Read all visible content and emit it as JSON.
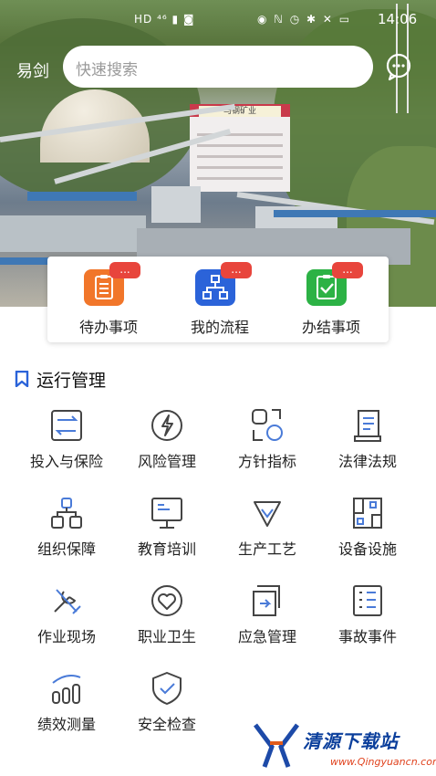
{
  "status_bar": {
    "left_icons": "HD ⁴⁶ ▮ ◙",
    "right_icons": "◉ ℕ ◷ ✱ ✕ ▭",
    "time": "14:06"
  },
  "header": {
    "user_name": "易剑",
    "search_placeholder": "快速搜索",
    "message_icon": "chat-bubble-icon"
  },
  "hero": {
    "building_sign": "马钢矿业"
  },
  "quick_actions": [
    {
      "label": "待办事项",
      "badge": "...",
      "color": "#f1762a",
      "icon": "clipboard-list-icon"
    },
    {
      "label": "我的流程",
      "badge": "...",
      "color": "#2b63d9",
      "icon": "flow-chart-icon"
    },
    {
      "label": "办结事项",
      "badge": "...",
      "color": "#2cb245",
      "icon": "clipboard-check-icon"
    }
  ],
  "section": {
    "title": "运行管理",
    "accent": "#2b63d9"
  },
  "grid": [
    {
      "label": "投入与保险",
      "icon": "exchange-card-icon"
    },
    {
      "label": "风险管理",
      "icon": "lightning-circle-icon"
    },
    {
      "label": "方针指标",
      "icon": "shapes-icon"
    },
    {
      "label": "法律法规",
      "icon": "scroll-icon"
    },
    {
      "label": "组织保障",
      "icon": "org-structure-icon"
    },
    {
      "label": "教育培训",
      "icon": "monitor-icon"
    },
    {
      "label": "生产工艺",
      "icon": "gem-icon"
    },
    {
      "label": "设备设施",
      "icon": "floorplan-icon"
    },
    {
      "label": "作业现场",
      "icon": "tools-icon"
    },
    {
      "label": "职业卫生",
      "icon": "heart-circle-icon"
    },
    {
      "label": "应急管理",
      "icon": "exit-arrow-icon"
    },
    {
      "label": "事故事件",
      "icon": "checklist-icon"
    },
    {
      "label": "绩效测量",
      "icon": "trend-chart-icon"
    },
    {
      "label": "安全检查",
      "icon": "shield-check-icon"
    }
  ],
  "watermark": {
    "title": "清源下载站",
    "url": "www.Qingyuancn.com"
  }
}
